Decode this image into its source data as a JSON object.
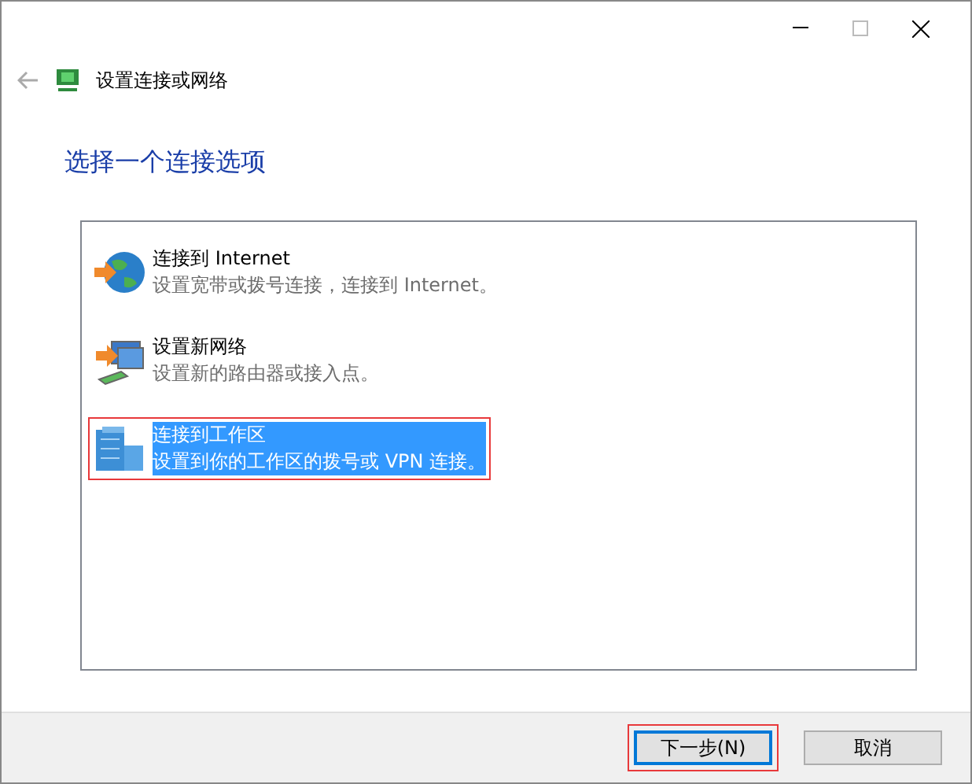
{
  "window": {
    "title": "设置连接或网络"
  },
  "heading": "选择一个连接选项",
  "options": [
    {
      "kind": "internet",
      "title": "连接到 Internet",
      "description": "设置宽带或拨号连接，连接到 Internet。",
      "selected": false,
      "annotated": false
    },
    {
      "kind": "network",
      "title": "设置新网络",
      "description": "设置新的路由器或接入点。",
      "selected": false,
      "annotated": false
    },
    {
      "kind": "workplace",
      "title": "连接到工作区",
      "description": "设置到你的工作区的拨号或 VPN 连接。",
      "selected": true,
      "annotated": true
    }
  ],
  "buttons": [
    {
      "label": "下一步(N)",
      "default": true,
      "annotated": true
    },
    {
      "label": "取消",
      "default": false,
      "annotated": false
    }
  ]
}
